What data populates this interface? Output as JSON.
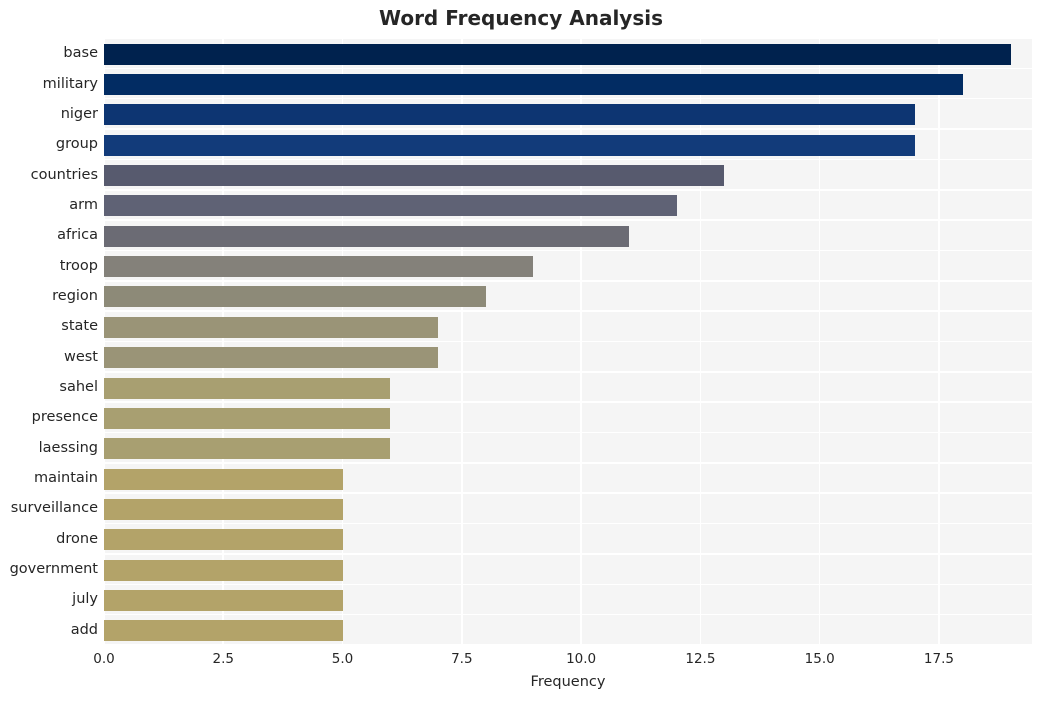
{
  "chart_data": {
    "type": "bar",
    "orientation": "horizontal",
    "title": "Word Frequency Analysis",
    "xlabel": "Frequency",
    "ylabel": "",
    "xlim": [
      0,
      19.45
    ],
    "xticks": [
      "0.0",
      "2.5",
      "5.0",
      "7.5",
      "10.0",
      "12.5",
      "15.0",
      "17.5"
    ],
    "xtick_values": [
      0,
      2.5,
      5,
      7.5,
      10,
      12.5,
      15,
      17.5
    ],
    "grid": true,
    "legend": "none",
    "categories": [
      "base",
      "military",
      "niger",
      "group",
      "countries",
      "arm",
      "africa",
      "troop",
      "region",
      "state",
      "west",
      "sahel",
      "presence",
      "laessing",
      "maintain",
      "surveillance",
      "drone",
      "government",
      "july",
      "add"
    ],
    "values": [
      19,
      18,
      17,
      17,
      13,
      12,
      11,
      9,
      8,
      7,
      7,
      6,
      6,
      6,
      5,
      5,
      5,
      5,
      5,
      5
    ],
    "colors": [
      "#00224e",
      "#022c63",
      "#0d3572",
      "#123b7a",
      "#575a6e",
      "#5f6275",
      "#6b6b74",
      "#84817a",
      "#8d8a78",
      "#9a9477",
      "#9a9477",
      "#a89f71",
      "#a89f71",
      "#a89f71",
      "#b3a369",
      "#b3a369",
      "#b3a369",
      "#b3a369",
      "#b3a369",
      "#b3a369"
    ],
    "plot_bg": "#f5f5f5",
    "grid_color": "#ffffff",
    "text_color": "#262626"
  }
}
